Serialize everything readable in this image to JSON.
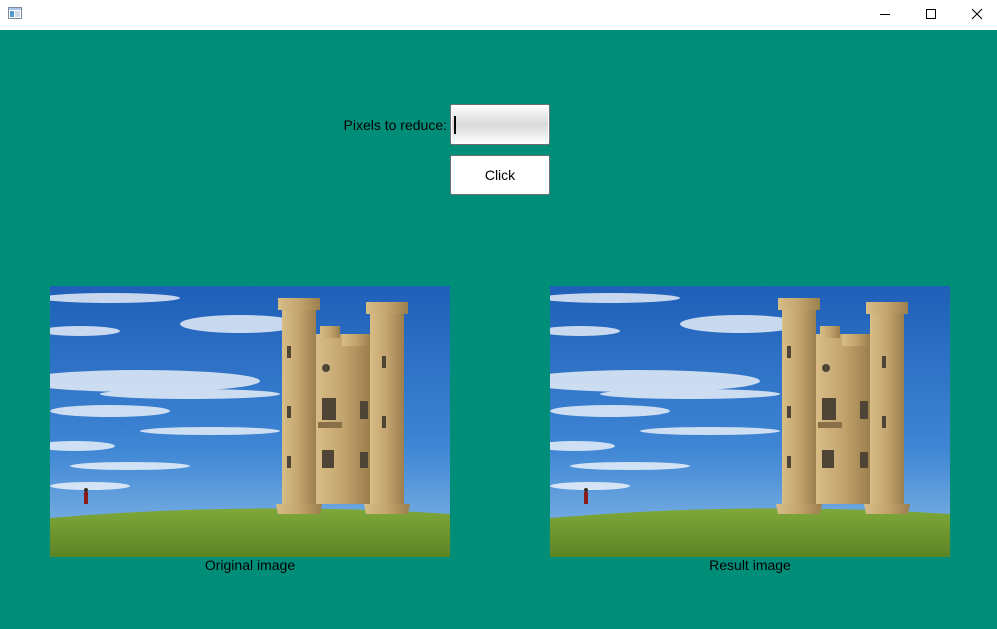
{
  "window": {
    "title": "",
    "controls": {
      "minimize_icon": "minimize-icon",
      "maximize_icon": "maximize-icon",
      "close_icon": "close-icon"
    }
  },
  "form": {
    "pixels_label": "Pixels to reduce:",
    "pixels_value": "",
    "click_label": "Click"
  },
  "images": {
    "original_caption": "Original image",
    "result_caption": "Result image",
    "subject": "stone tower on grassy hill under blue sky"
  },
  "colors": {
    "background": "#008e79",
    "titlebar": "#ffffff",
    "sky": "#2f6fc4",
    "grass": "#6f9a2a",
    "stone": "#c3a46e"
  }
}
